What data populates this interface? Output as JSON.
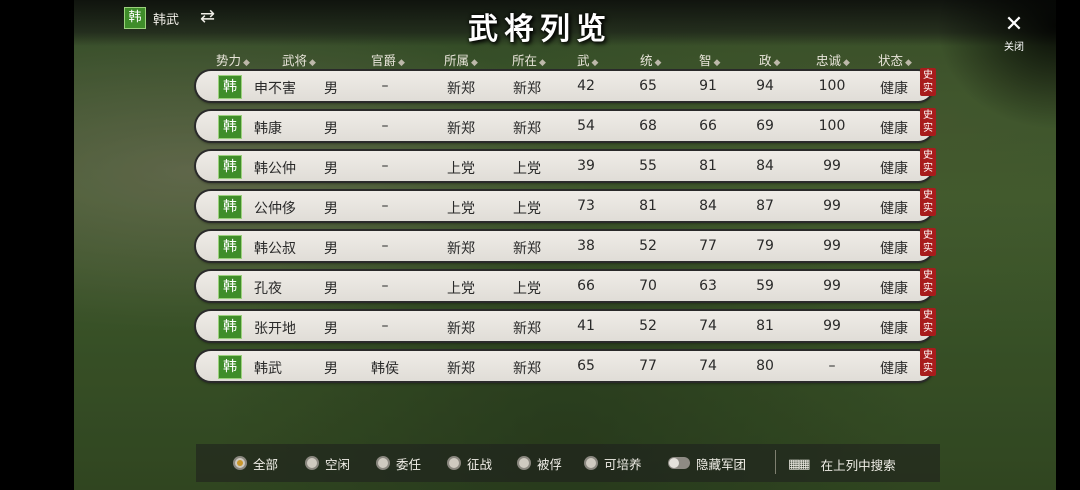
{
  "header": {
    "ruler_badge": "韩",
    "ruler_name": "韩武",
    "title": "武将列览",
    "close_label": "关闭"
  },
  "columns": [
    "势力",
    "武将",
    "官爵",
    "所属",
    "所在",
    "武",
    "统",
    "智",
    "政",
    "忠诚",
    "状态"
  ],
  "rows": [
    {
      "faction": "韩",
      "name": "申不害",
      "gender": "男",
      "rank": "–",
      "belong": "新郑",
      "location": "新郑",
      "war": "42",
      "lead": "65",
      "intel": "91",
      "pol": "94",
      "loyalty": "100",
      "status": "健康",
      "tag": "史实"
    },
    {
      "faction": "韩",
      "name": "韩康",
      "gender": "男",
      "rank": "–",
      "belong": "新郑",
      "location": "新郑",
      "war": "54",
      "lead": "68",
      "intel": "66",
      "pol": "69",
      "loyalty": "100",
      "status": "健康",
      "tag": "史实"
    },
    {
      "faction": "韩",
      "name": "韩公仲",
      "gender": "男",
      "rank": "–",
      "belong": "上党",
      "location": "上党",
      "war": "39",
      "lead": "55",
      "intel": "81",
      "pol": "84",
      "loyalty": "99",
      "status": "健康",
      "tag": "史实"
    },
    {
      "faction": "韩",
      "name": "公仲侈",
      "gender": "男",
      "rank": "–",
      "belong": "上党",
      "location": "上党",
      "war": "73",
      "lead": "81",
      "intel": "84",
      "pol": "87",
      "loyalty": "99",
      "status": "健康",
      "tag": "史实"
    },
    {
      "faction": "韩",
      "name": "韩公叔",
      "gender": "男",
      "rank": "–",
      "belong": "新郑",
      "location": "新郑",
      "war": "38",
      "lead": "52",
      "intel": "77",
      "pol": "79",
      "loyalty": "99",
      "status": "健康",
      "tag": "史实"
    },
    {
      "faction": "韩",
      "name": "孔夜",
      "gender": "男",
      "rank": "–",
      "belong": "上党",
      "location": "上党",
      "war": "66",
      "lead": "70",
      "intel": "63",
      "pol": "59",
      "loyalty": "99",
      "status": "健康",
      "tag": "史实"
    },
    {
      "faction": "韩",
      "name": "张开地",
      "gender": "男",
      "rank": "–",
      "belong": "新郑",
      "location": "新郑",
      "war": "41",
      "lead": "52",
      "intel": "74",
      "pol": "81",
      "loyalty": "99",
      "status": "健康",
      "tag": "史实"
    },
    {
      "faction": "韩",
      "name": "韩武",
      "gender": "男",
      "rank": "韩侯",
      "belong": "新郑",
      "location": "新郑",
      "war": "65",
      "lead": "77",
      "intel": "74",
      "pol": "80",
      "loyalty": "–",
      "status": "健康",
      "tag": "史实"
    }
  ],
  "filters": {
    "all": "全部",
    "idle": "空闲",
    "assigned": "委任",
    "campaign": "征战",
    "captive": "被俘",
    "trainable": "可培养",
    "hide_legion": "隐藏军团"
  },
  "search_label": "在上列中搜索"
}
